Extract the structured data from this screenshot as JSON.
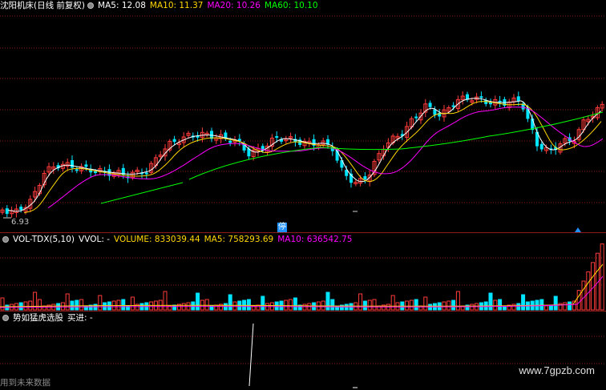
{
  "main_legend": {
    "title": "沈阳机床(日线 前复权)",
    "ma5": "MA5: 12.08",
    "ma10": "MA10: 11.37",
    "ma20": "MA20: 10.26",
    "ma60": "MA60: 10.10"
  },
  "vol_legend": {
    "title": "VOL-TDX(5,10)",
    "vvol": "VVOL: -",
    "volume": "VOLUME: 833039.44",
    "ma5": "MA5: 758293.69",
    "ma10": "MA10: 636542.75"
  },
  "ind_legend": {
    "title": "势如猛虎选股",
    "buy": "买进: -"
  },
  "low_label": "6.93",
  "stop_badge": "停",
  "watermark": "www.7gpzb.com",
  "bottom_text": "用到未来数据",
  "colors": {
    "up": "#ff3b3b",
    "down": "#00e5ff",
    "ma5": "#ffffff",
    "ma10": "#ffd700",
    "ma20": "#ff00ff",
    "ma60": "#00ff00",
    "grid": "#8b1a1a"
  },
  "icons": [
    "settings-circle-icon"
  ]
}
